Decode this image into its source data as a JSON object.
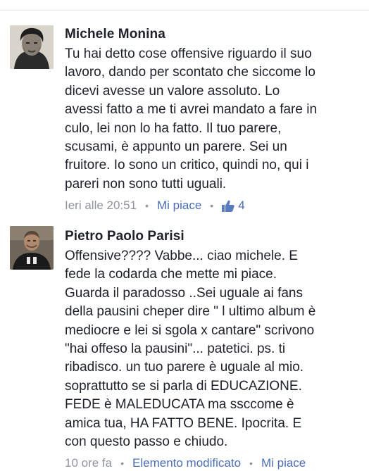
{
  "comments": [
    {
      "author": "Michele Monina",
      "text": "Tu hai detto cose offensive riguardo il suo\nlavoro, dando per scontato che siccome lo\ndicevi avesse un valore assoluto. Lo\navessi fatto a me ti avrei mandato a fare in\nculo, lei non lo ha fatto. Il tuo parere,\nscusami, è appunto un parere. Sei un\nfruitore. Io sono un critico, quindi no, qui i\npareri non sono tutti uguali.",
      "time": "Ieri alle 20:51",
      "like_label": "Mi piace",
      "like_count": "4",
      "colors": {
        "like_icon": "#5b7bc0"
      }
    },
    {
      "author": "Pietro Paolo Parisi",
      "text": "Offensive???? Vabbe... ciao michele. E\nfede la codarda che mette mi piace.\nGuarda il paradosso ..Sei uguale ai fans\ndella pausini cheper dire \" l ultimo album è\nmediocre e lei si sgola x cantare\" scrivono\n\"hai offeso la pausini\"... patetici. ps. ti\nribadisco. un tuo parere è uguale al mio.\nsoprattutto se si parla di EDUCAZIONE.\nFEDE è MALEDUCATA ma ssccome è\namica tua, HA FATTO BENE. Ipocrita. E\ncon questo passo e chiudo.",
      "time": "10 ore fa",
      "edited_label": "Elemento modificato",
      "like_label": "Mi piace"
    }
  ],
  "icons": {
    "like": "thumbs-up-icon",
    "separator": "dot-separator"
  },
  "colors": {
    "meta": "#90949c",
    "link": "#4b6eb5",
    "text": "#1d2129"
  }
}
